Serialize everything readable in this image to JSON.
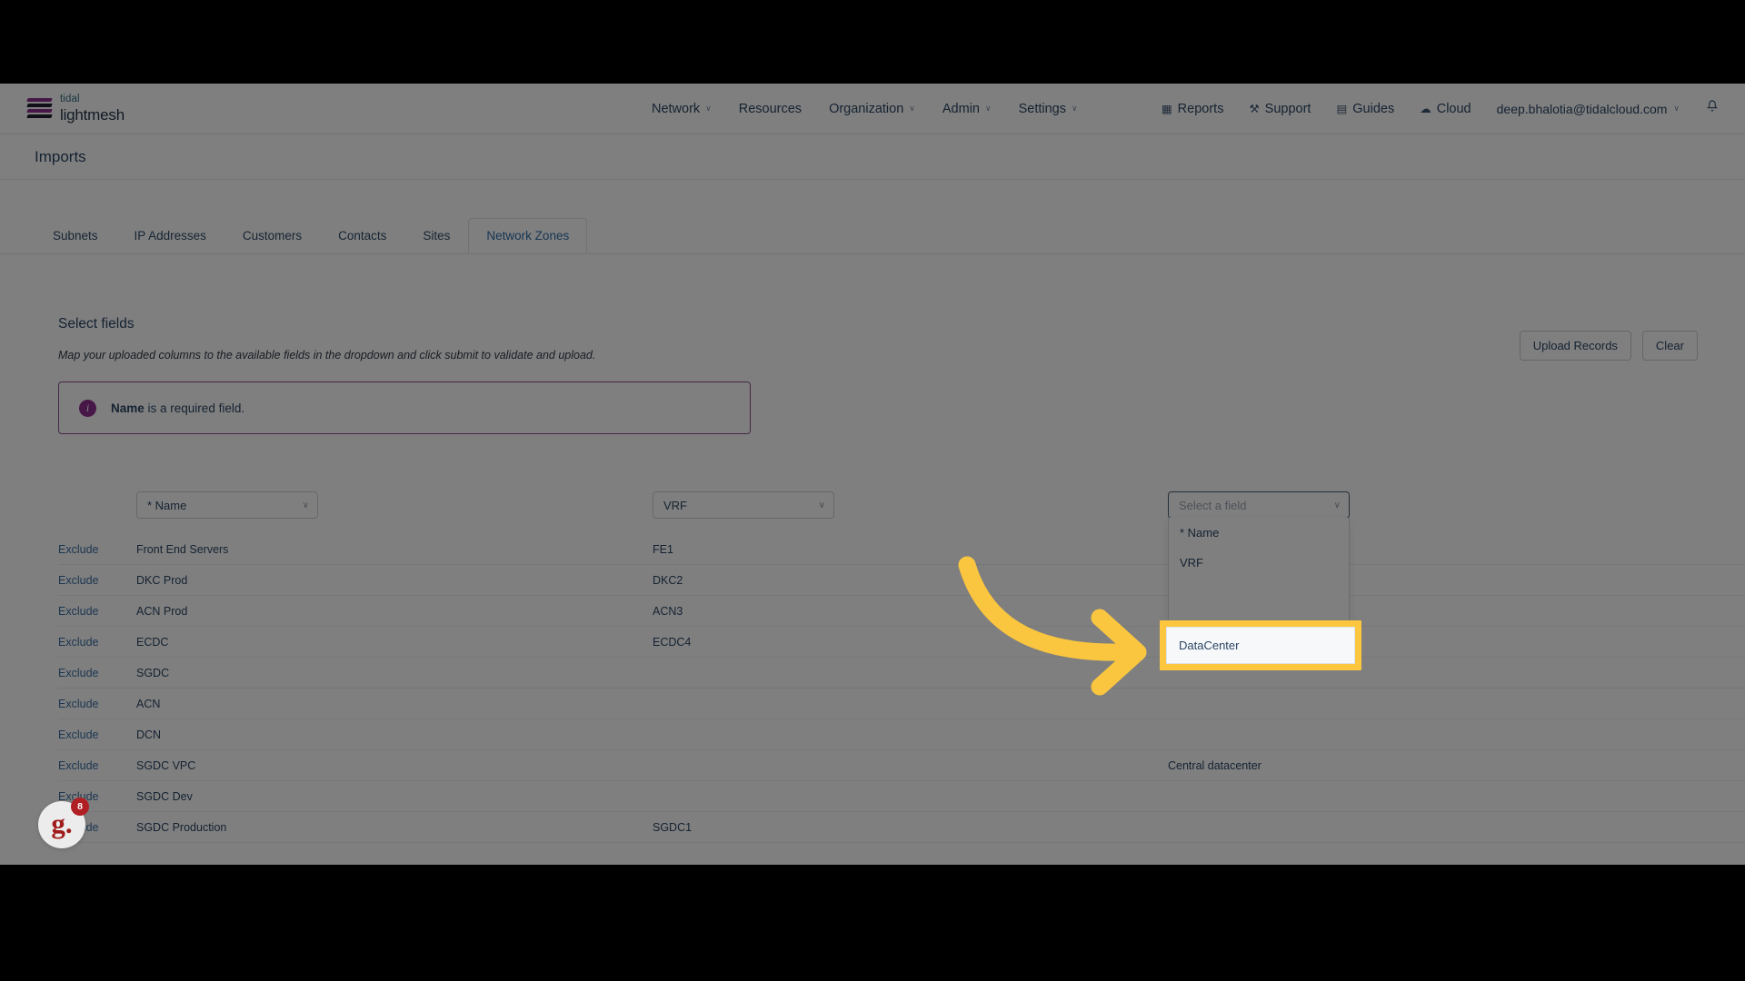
{
  "brand": {
    "top": "tidal",
    "bottom": "lightmesh",
    "icon": "stacked-layers-logo"
  },
  "topnav": {
    "center_items": [
      {
        "label": "Network",
        "caret": "∨"
      },
      {
        "label": "Resources",
        "caret": ""
      },
      {
        "label": "Organization",
        "caret": "∨"
      },
      {
        "label": "Admin",
        "caret": "∨"
      },
      {
        "label": "Settings",
        "caret": "∨"
      }
    ],
    "right_items": [
      {
        "label": "Reports",
        "icon": "chart-icon",
        "glyph": "▦"
      },
      {
        "label": "Support",
        "icon": "wrench-icon",
        "glyph": "⚒"
      },
      {
        "label": "Guides",
        "icon": "book-icon",
        "glyph": "▤"
      },
      {
        "label": "Cloud",
        "icon": "cloud-icon",
        "glyph": "☁"
      }
    ],
    "user": "deep.bhalotia@tidalcloud.com",
    "user_caret": "∨",
    "bell": "ὑ4"
  },
  "page": {
    "title": "Imports"
  },
  "tabs": [
    {
      "label": "Subnets",
      "active": false
    },
    {
      "label": "IP Addresses",
      "active": false
    },
    {
      "label": "Customers",
      "active": false
    },
    {
      "label": "Contacts",
      "active": false
    },
    {
      "label": "Sites",
      "active": false
    },
    {
      "label": "Network Zones",
      "active": true
    }
  ],
  "section": {
    "title": "Select fields",
    "subtitle": "Map your uploaded columns to the available fields in the dropdown and click submit to validate and upload."
  },
  "actions": {
    "upload": "Upload Records",
    "clear": "Clear"
  },
  "alert": {
    "icon_glyph": "i",
    "bold": "Name",
    "rest": " is a required field.",
    "accent": "#8e2f8e"
  },
  "selects": {
    "col1": {
      "value": "* Name",
      "caret": "∨"
    },
    "col2": {
      "value": "VRF",
      "caret": "∨"
    },
    "col3": {
      "placeholder": "Select a field",
      "caret": "∨"
    }
  },
  "dropdown_menu": {
    "items": [
      {
        "label": "* Name",
        "highlighted": false
      },
      {
        "label": "VRF",
        "highlighted": false
      }
    ],
    "highlighted_item": "DataCenter"
  },
  "table": {
    "exclude_label": "Exclude",
    "rows": [
      {
        "exclude": "Exclude",
        "name": "Front End Servers",
        "vrf": "FE1",
        "dc": ""
      },
      {
        "exclude": "Exclude",
        "name": "DKC Prod",
        "vrf": "DKC2",
        "dc": ""
      },
      {
        "exclude": "Exclude",
        "name": "ACN Prod",
        "vrf": "ACN3",
        "dc": ""
      },
      {
        "exclude": "Exclude",
        "name": "ECDC",
        "vrf": "ECDC4",
        "dc": ""
      },
      {
        "exclude": "Exclude",
        "name": "SGDC",
        "vrf": "",
        "dc": ""
      },
      {
        "exclude": "Exclude",
        "name": "ACN",
        "vrf": "",
        "dc": ""
      },
      {
        "exclude": "Exclude",
        "name": "DCN",
        "vrf": "",
        "dc": ""
      },
      {
        "exclude": "Exclude",
        "name": "SGDC VPC",
        "vrf": "",
        "dc": "Central datacenter"
      },
      {
        "exclude": "Exclude",
        "name": "SGDC Dev",
        "vrf": "",
        "dc": ""
      },
      {
        "exclude": "Exclude",
        "name": "SGDC Production",
        "vrf": "SGDC1",
        "dc": ""
      }
    ]
  },
  "chat_widget": {
    "logo": "g.",
    "count": "8"
  },
  "annotation": {
    "arrow_color": "#fbc63f",
    "highlight_color": "#fcc63f"
  }
}
